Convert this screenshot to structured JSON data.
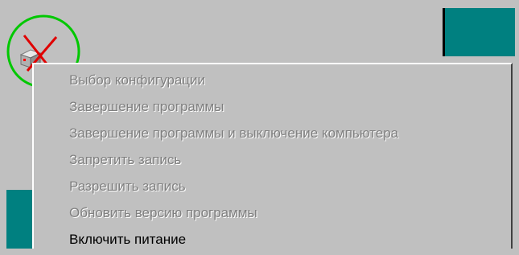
{
  "colors": {
    "desktop_gray": "#c0c0c0",
    "teal": "#008080",
    "icon_ring": "#00c800",
    "icon_cross": "#e00000",
    "disabled_text": "#808080",
    "enabled_text": "#000000"
  },
  "tray_icon": {
    "icon": "power-off-icon"
  },
  "context_menu": {
    "items": [
      {
        "label": "Выбор конфигурации",
        "enabled": false
      },
      {
        "label": "Завершение программы",
        "enabled": false
      },
      {
        "label": "Завершение программы и выключение компьютера",
        "enabled": false
      },
      {
        "label": "Запретить запись",
        "enabled": false
      },
      {
        "label": "Разрешить запись",
        "enabled": false
      },
      {
        "label": "Обновить версию программы",
        "enabled": false
      },
      {
        "label": "Включить питание",
        "enabled": true
      }
    ]
  }
}
